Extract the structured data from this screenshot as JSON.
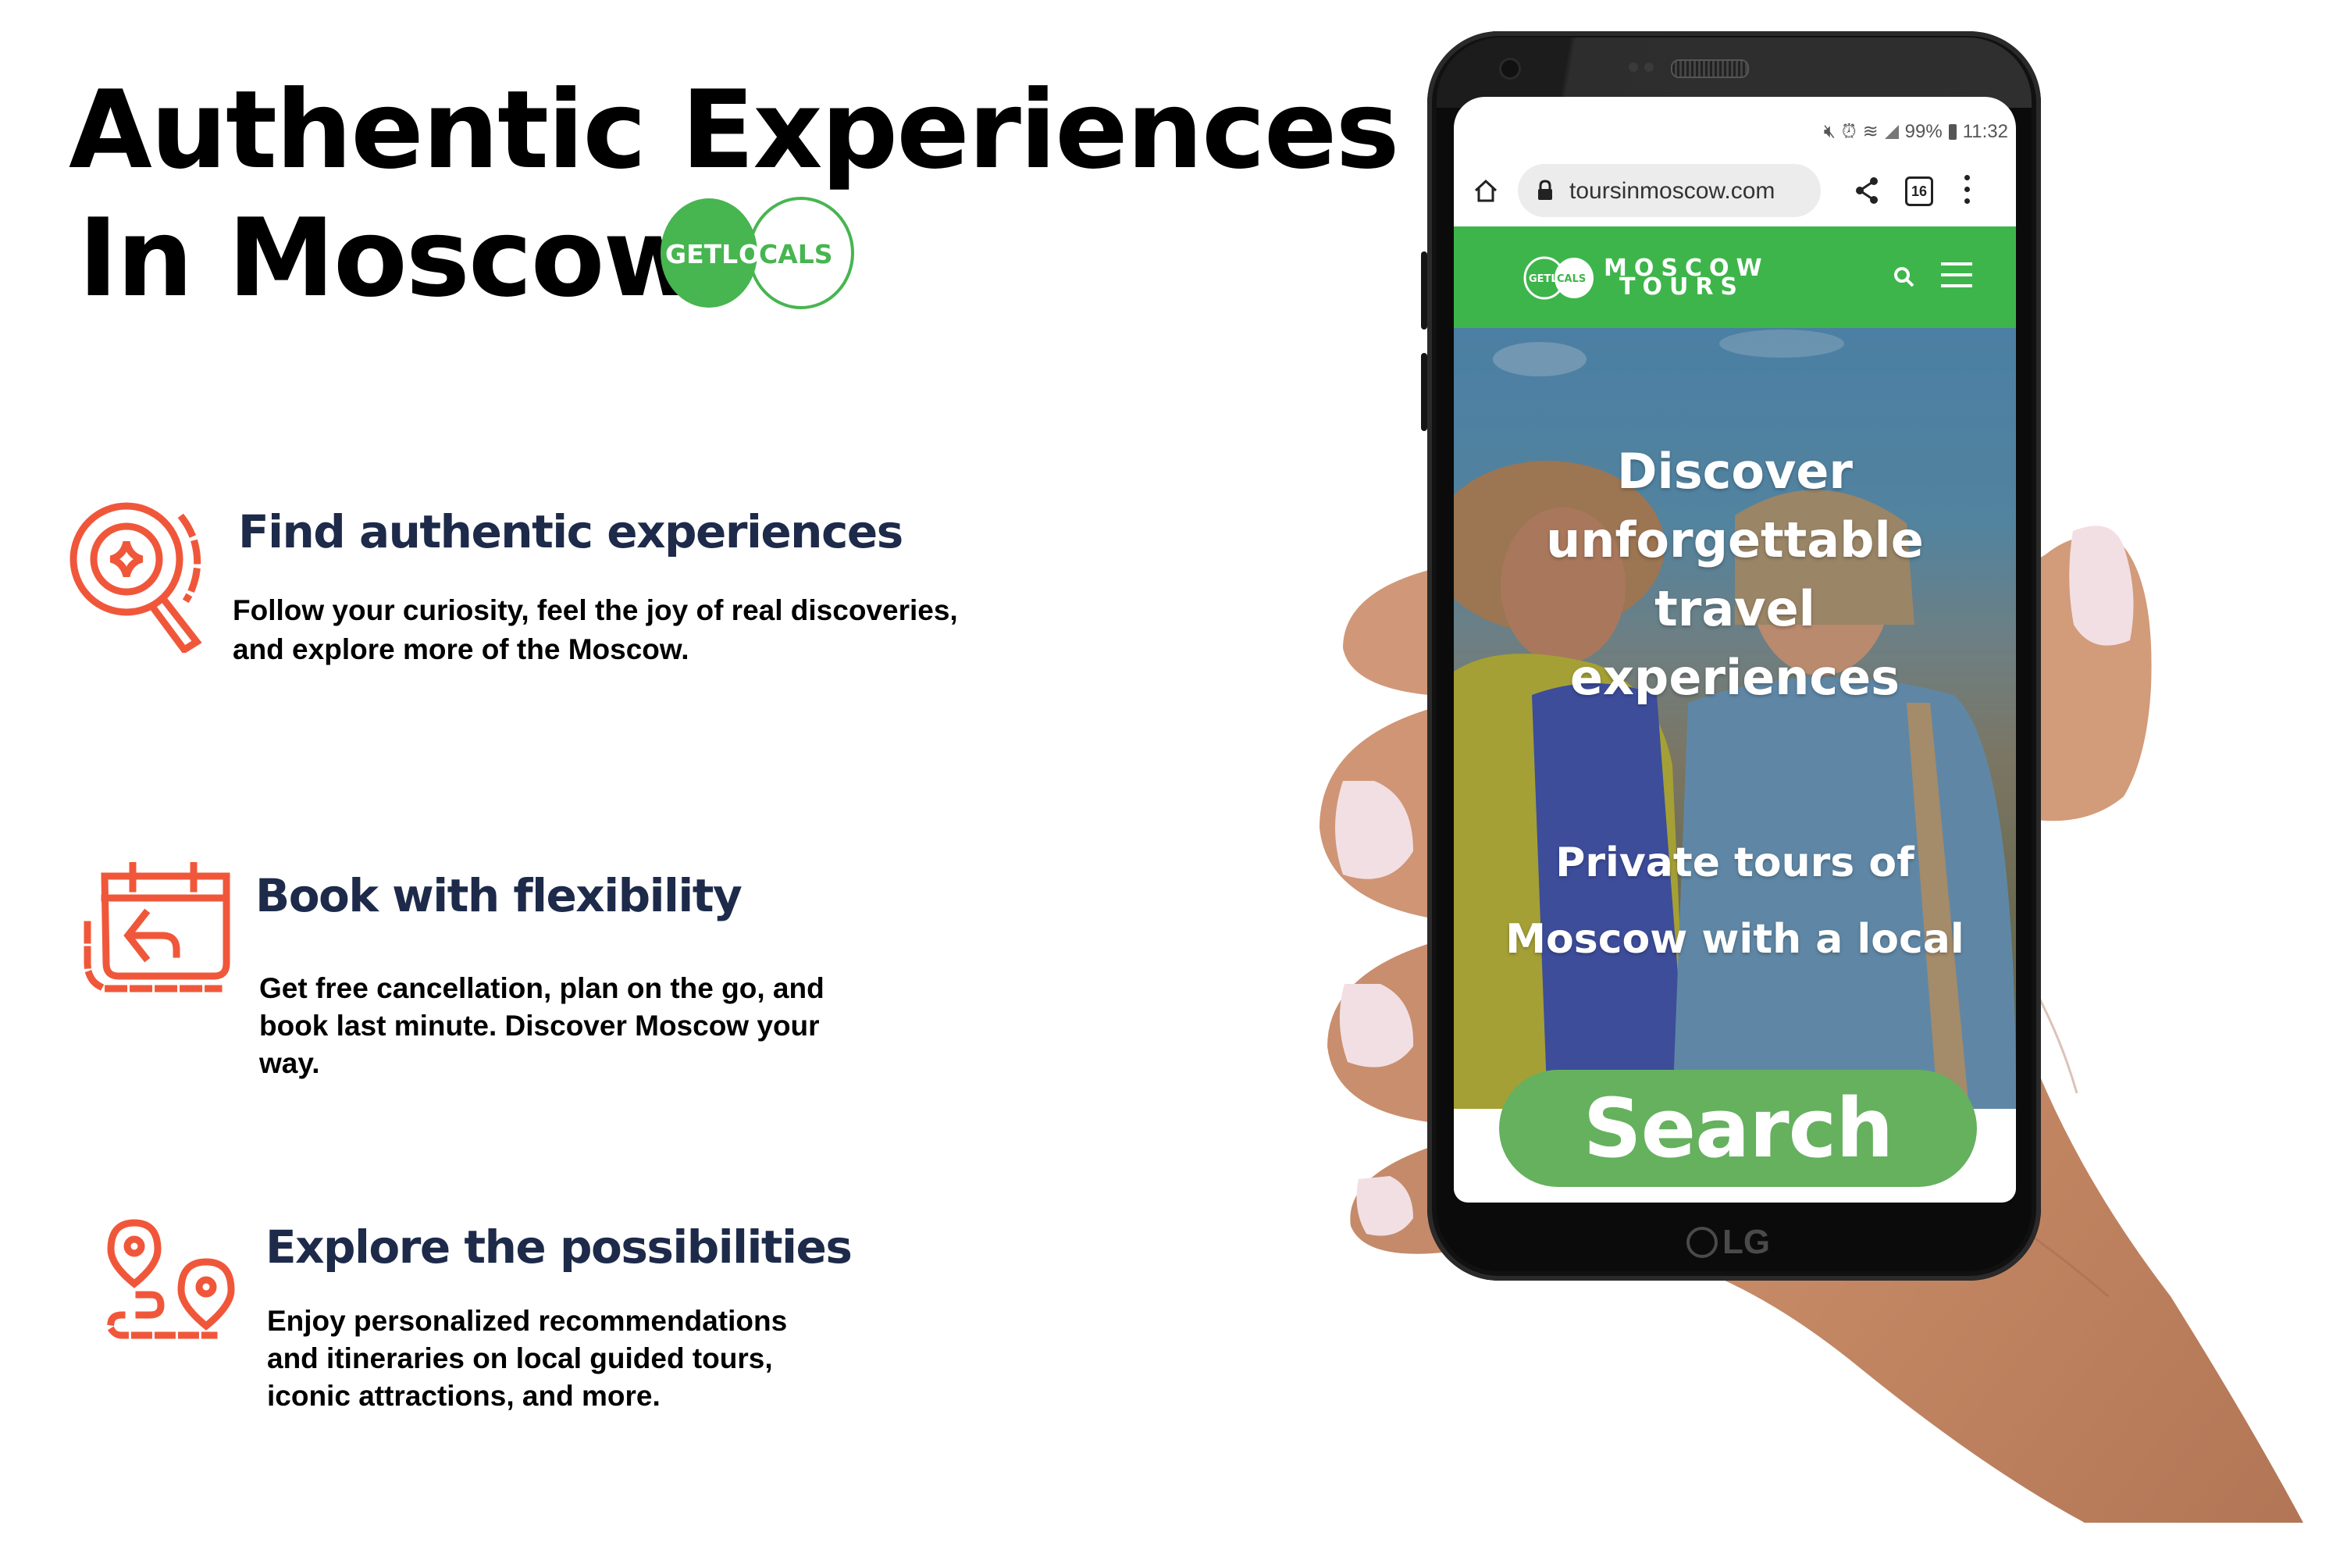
{
  "header": {
    "title_line1": "Authentic Experiences",
    "title_line2": "In Moscow",
    "logo": {
      "text_left": "GETL",
      "text_mid": "O",
      "text_right": "CALS",
      "color": "#47b550"
    }
  },
  "features": [
    {
      "icon": "search-sparkle-icon",
      "heading": "Find authentic experiences",
      "body_lines": [
        "Follow your curiosity, feel the joy of real discoveries,",
        " and explore more of the Moscow."
      ]
    },
    {
      "icon": "calendar-undo-icon",
      "heading": "Book with flexibility",
      "body_lines": [
        "Get free cancellation, plan on the go, and",
        "book last minute. Discover Moscow your",
        "way."
      ]
    },
    {
      "icon": "map-pins-route-icon",
      "heading": "Explore the possibilities",
      "body_lines": [
        "Enjoy personalized recommendations",
        "and itineraries on local guided tours,",
        "iconic attractions, and more."
      ]
    }
  ],
  "phone": {
    "brand": "LG",
    "status_bar": {
      "battery": "99%",
      "time": "11:32",
      "icons": [
        "mute-icon",
        "alarm-icon",
        "wifi-icon",
        "signal-icon",
        "battery-icon"
      ]
    },
    "browser": {
      "url": "toursinmoscow.com",
      "tab_count": "16"
    },
    "site": {
      "logo_small": "GETLOCALS",
      "brand_line1": "MOSCOW",
      "brand_line2": "TOURS",
      "header_color": "#3db54a",
      "hero_title_lines": [
        "Discover",
        "unforgettable",
        "travel",
        "experiences"
      ],
      "hero_subtitle_lines": [
        "Private tours of",
        "Moscow with a local"
      ],
      "search_label": "Search",
      "search_color": "#65b15e"
    }
  },
  "colors": {
    "accent_icon": "#f0573a",
    "heading_navy": "#1d2a4a",
    "brand_green": "#47b550"
  }
}
